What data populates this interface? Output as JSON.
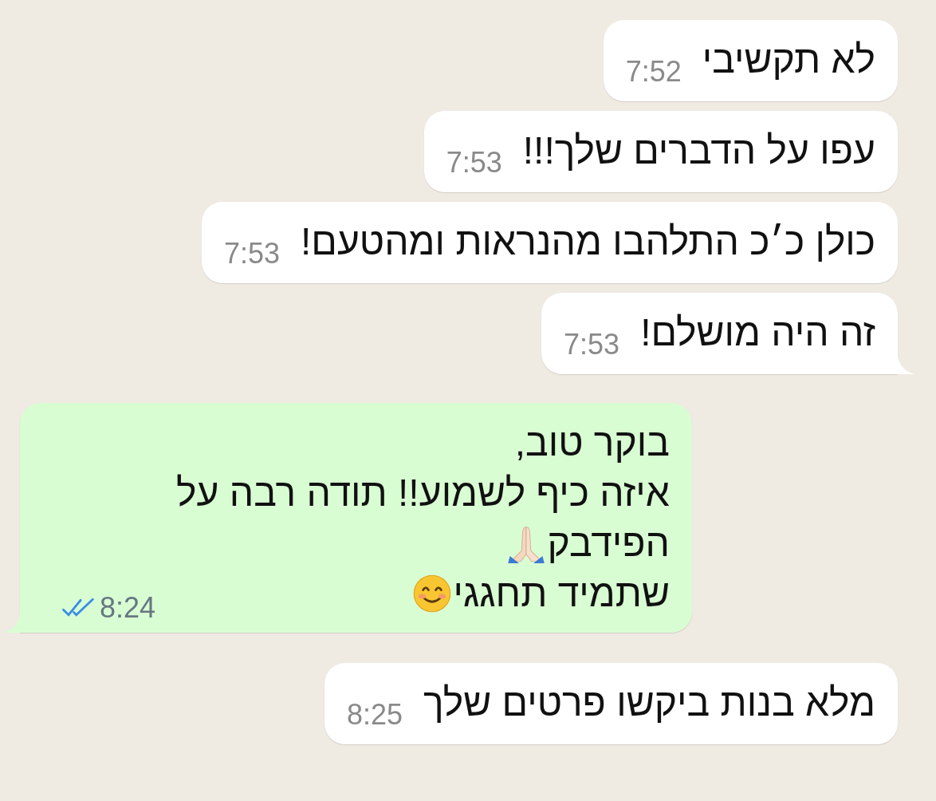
{
  "messages": [
    {
      "outgoing": false,
      "tail": false,
      "lines": [
        {
          "kind": "plain",
          "text": "לא תקשיבי"
        }
      ],
      "time": "7:52"
    },
    {
      "outgoing": false,
      "tail": false,
      "lines": [
        {
          "kind": "plain",
          "text": "עפו על הדברים שלך!!!"
        }
      ],
      "time": "7:53"
    },
    {
      "outgoing": false,
      "tail": false,
      "lines": [
        {
          "kind": "plain",
          "text": "כולן כ׳כ התלהבו מהנראות ומהטעם!"
        }
      ],
      "time": "7:53"
    },
    {
      "outgoing": false,
      "tail": true,
      "lines": [
        {
          "kind": "plain",
          "text": "זה היה מושלם!"
        }
      ],
      "time": "7:53"
    },
    {
      "outgoing": true,
      "tail": true,
      "lines": [
        {
          "kind": "plain",
          "text": "בוקר טוב,"
        },
        {
          "kind": "plain",
          "text": "איזה כיף לשמוע!! תודה רבה על"
        },
        {
          "kind": "hands",
          "text": "הפידבק"
        },
        {
          "kind": "smile",
          "text": "שתמיד תחגגי"
        }
      ],
      "time": "8:24",
      "read": true
    },
    {
      "outgoing": false,
      "tail": false,
      "lines": [
        {
          "kind": "plain",
          "text": "מלא בנות ביקשו פרטים שלך"
        }
      ],
      "time": "8:25"
    }
  ]
}
